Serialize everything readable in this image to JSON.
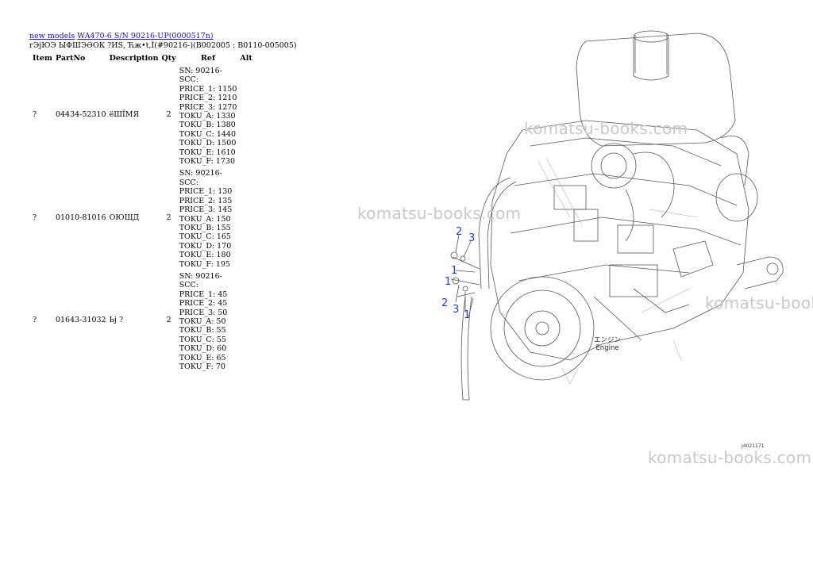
{
  "breadcrumb": {
    "link1": "new models",
    "link2": "WA470-6 S/N  90216-UP(0000517n)"
  },
  "subtitle": "гЭјЮЭ ЫФШЭӘОК ?ИЅ, Ћж•t,Ì(#90216-)(B002005 : B0110-005005)",
  "columns": {
    "item": "Item",
    "partno": "PartNo",
    "description": "Description",
    "qty": "Qty",
    "ref": "Ref",
    "alt": "Alt"
  },
  "rows": [
    {
      "item": "?",
      "partno": "04434-52310",
      "description": "ёШЇМЯ",
      "qty": "2",
      "prices": [
        "SN: 90216-",
        "SCC:",
        "PRICE_1: 1150",
        "PRICE_2: 1210",
        "PRICE_3: 1270",
        "TOKU_A: 1330",
        "TOKU_B: 1380",
        "TOKU_C: 1440",
        "TOKU_D: 1500",
        "TOKU_E: 1610",
        "TOKU_F: 1730"
      ]
    },
    {
      "item": "?",
      "partno": "01010-81016",
      "description": "ОЮЩД",
      "qty": "2",
      "prices": [
        "SN: 90216-",
        "SCC:",
        "PRICE_1: 130",
        "PRICE_2: 135",
        "PRICE_3: 145",
        "TOKU_A: 150",
        "TOKU_B: 155",
        "TOKU_C: 165",
        "TOKU_D: 170",
        "TOKU_E: 180",
        "TOKU_F: 195"
      ]
    },
    {
      "item": "?",
      "partno": "01643-31032",
      "description": "Ьј ?",
      "qty": "2",
      "prices": [
        "SN: 90216-",
        "SCC:",
        "PRICE_1: 45",
        "PRICE_2: 45",
        "PRICE_3: 50",
        "TOKU_A: 50",
        "TOKU_B: 55",
        "TOKU_C: 55",
        "TOKU_D: 60",
        "TOKU_E: 65",
        "TOKU_F: 70"
      ]
    }
  ],
  "diagram": {
    "watermark": "komatsu-books.com",
    "callouts": [
      "2",
      "3",
      "1",
      "1",
      "2",
      "3",
      "1"
    ],
    "engine_label_jp": "エンジン",
    "engine_label_en": "Engine",
    "figure_id": "J4021171"
  }
}
